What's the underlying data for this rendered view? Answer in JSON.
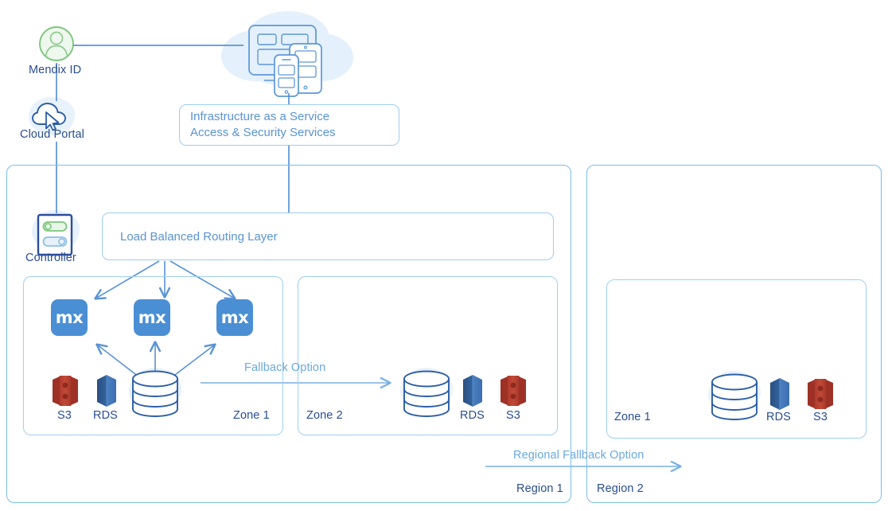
{
  "diagram": {
    "title": "Mendix Cloud Architecture",
    "colors": {
      "line": "#5a93d4",
      "box_border": "#7cbdec",
      "text_dark": "#2a4d91",
      "text_light": "#6aa9e0",
      "mx_blue": "#4a8fd4",
      "s3_red": "#b5382c",
      "rds_blue": "#2e5a96",
      "green": "#7dc57d",
      "blob": "#e8f2fc"
    }
  },
  "identity": {
    "mendix_id_label": "Mendix ID",
    "mendix_id_icon": "user-avatar-icon",
    "cloud_portal_label": "Cloud Portal",
    "cloud_portal_icon": "cloud-cursor-icon"
  },
  "devices": {
    "icon": "multi-device-cloud-icon",
    "items": [
      "desktop-monitor",
      "tablet",
      "smartphone"
    ]
  },
  "iaas": {
    "line1": "Infrastructure as a Service",
    "line2": "Access & Security Services",
    "shield_icon": "shield-flame-icon"
  },
  "controller": {
    "label": "Controller",
    "icon": "toggle-switches-icon",
    "toggles": [
      {
        "state": "on",
        "color": "#7dc57d"
      },
      {
        "state": "on",
        "color": "#6aa9e0"
      }
    ]
  },
  "load_balancer": {
    "label": "Load Balanced Routing Layer",
    "nodes": [
      {
        "name": "router-node-1",
        "icon": "server-rack-icon",
        "leds": [
          "#5a9fe0",
          "#7dc57d",
          "#d9654a"
        ]
      },
      {
        "name": "router-node-2",
        "icon": "server-rack-icon",
        "leds": [
          "#5a9fe0",
          "#7dc57d",
          "#d9654a"
        ]
      },
      {
        "name": "router-node-3",
        "icon": "server-rack-icon",
        "leds": [
          "#5a9fe0",
          "#7dc57d",
          "#d9654a"
        ]
      }
    ],
    "connectors": [
      "bidirectional-arrow",
      "bidirectional-arrow"
    ]
  },
  "region1": {
    "label": "Region 1",
    "zones": [
      {
        "label": "Zone 1",
        "app_instances": [
          {
            "name": "mx-instance-1",
            "text": "mx"
          },
          {
            "name": "mx-instance-2",
            "text": "mx"
          },
          {
            "name": "mx-instance-3",
            "text": "mx"
          }
        ],
        "storage": [
          {
            "label": "S3",
            "icon": "aws-s3-icon",
            "color": "#b5382c"
          },
          {
            "label": "RDS",
            "icon": "aws-rds-icon",
            "color": "#2e5a96"
          }
        ],
        "database": {
          "label": "",
          "icon": "database-cylinder-icon"
        }
      },
      {
        "label": "Zone 2",
        "app_instances": [],
        "database": {
          "label": "",
          "icon": "database-cylinder-icon"
        },
        "storage": [
          {
            "label": "RDS",
            "icon": "aws-rds-icon",
            "color": "#2e5a96"
          },
          {
            "label": "S3",
            "icon": "aws-s3-icon",
            "color": "#b5382c"
          }
        ]
      }
    ],
    "fallback_label": "Fallback Option"
  },
  "region2": {
    "label": "Region 2",
    "zones": [
      {
        "label": "Zone 1",
        "database": {
          "label": "",
          "icon": "database-cylinder-icon"
        },
        "storage": [
          {
            "label": "RDS",
            "icon": "aws-rds-icon",
            "color": "#2e5a96"
          },
          {
            "label": "S3",
            "icon": "aws-s3-icon",
            "color": "#b5382c"
          }
        ]
      }
    ]
  },
  "regional_fallback_label": "Regional Fallback Option"
}
